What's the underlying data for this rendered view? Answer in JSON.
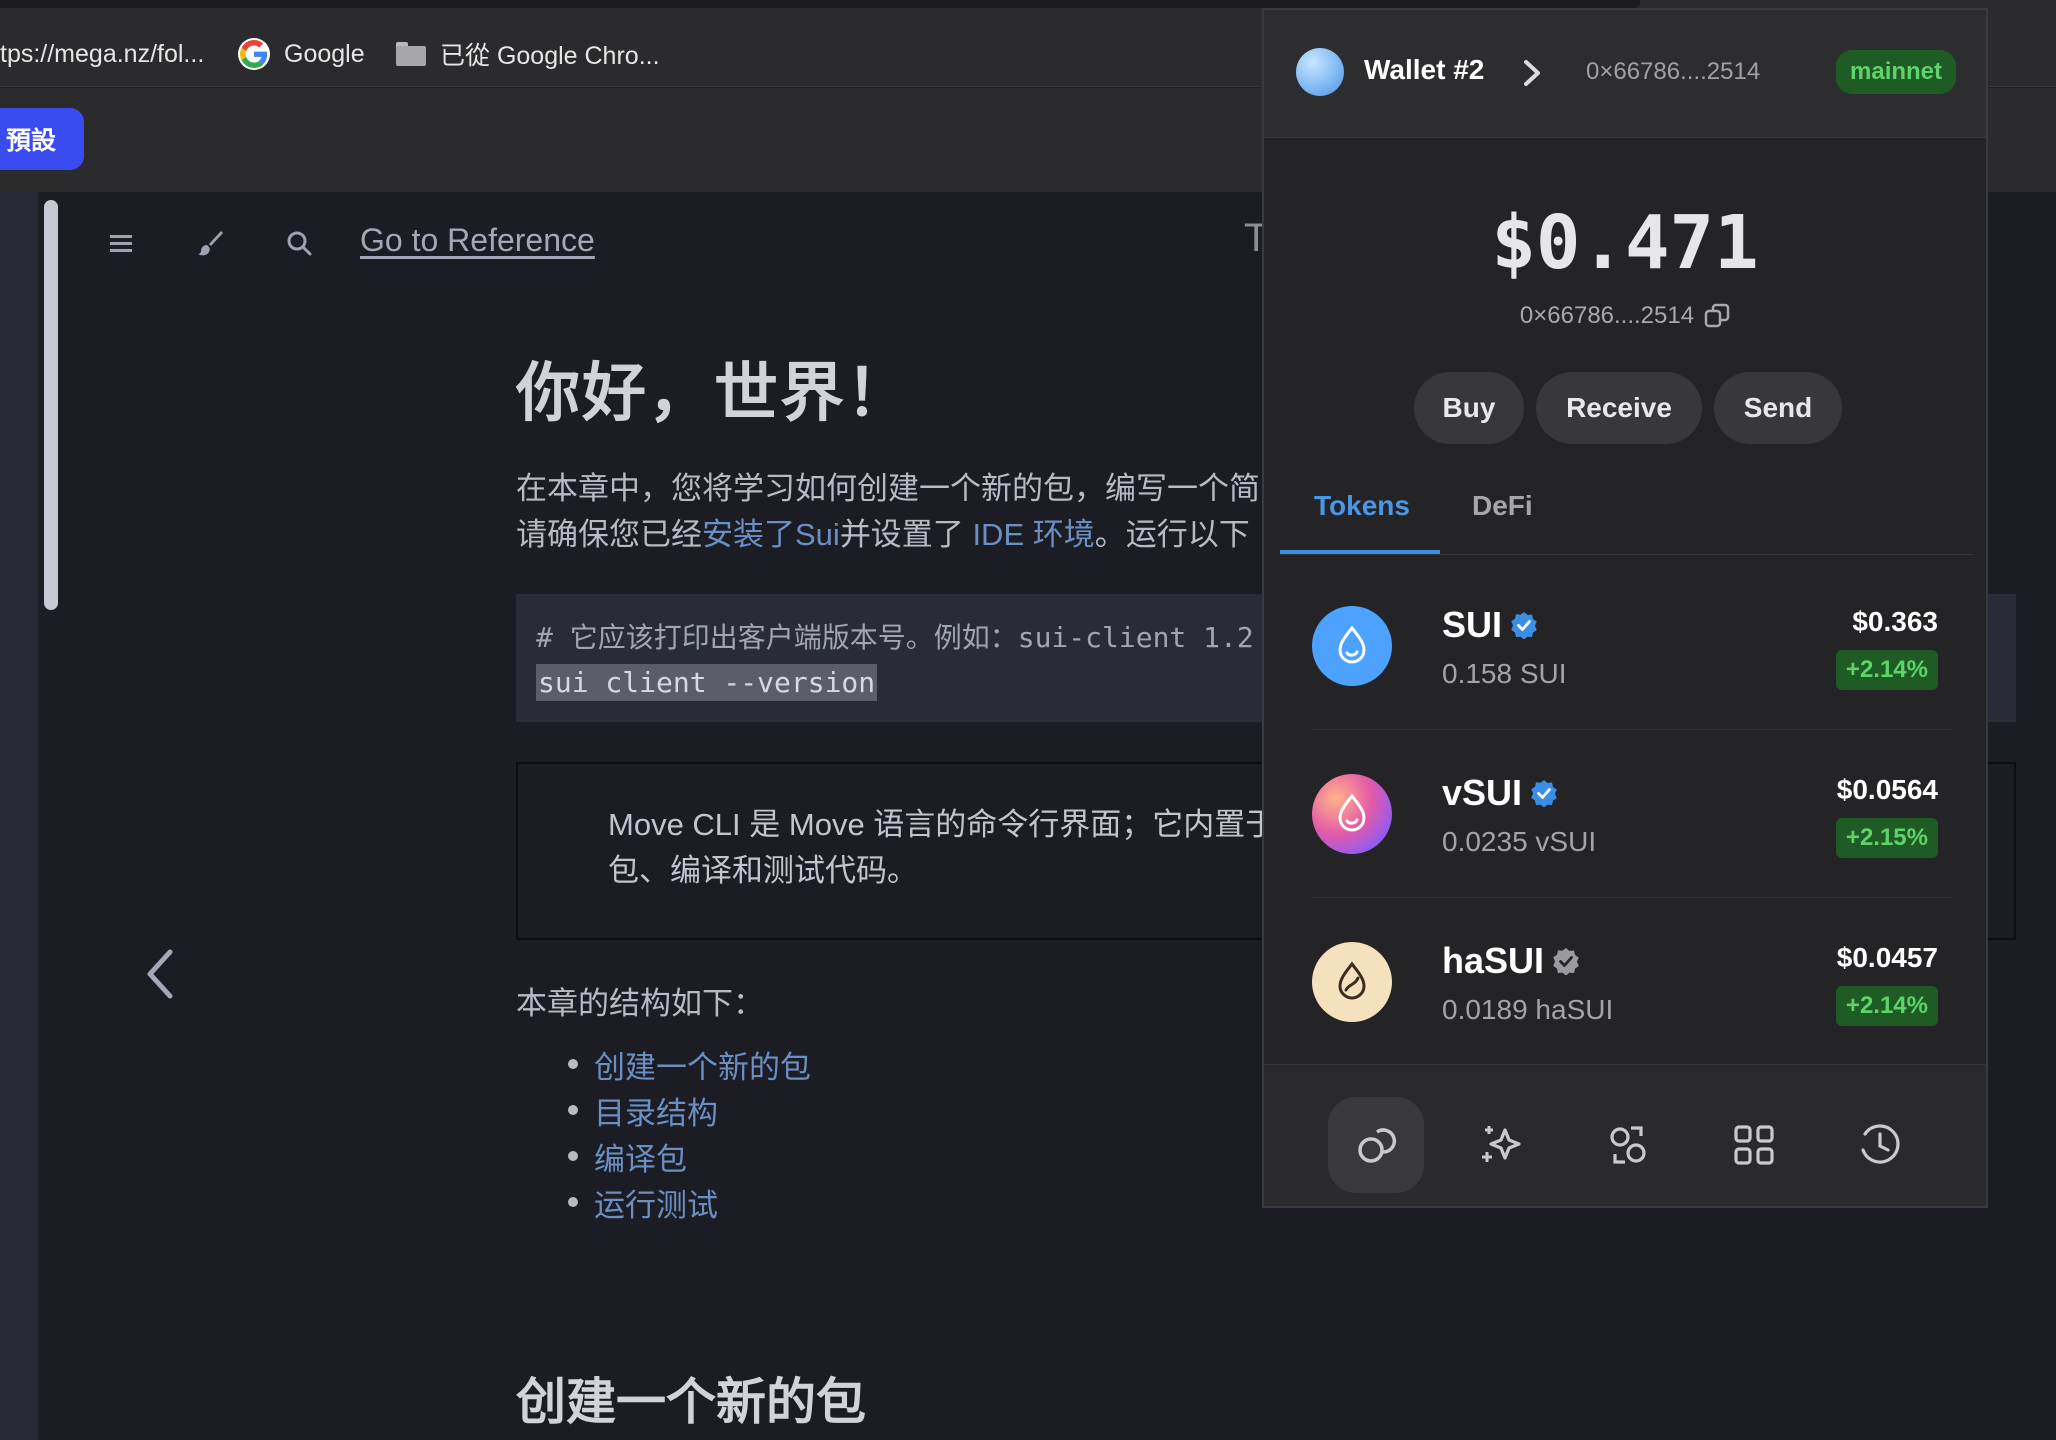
{
  "browser": {
    "bookmarks": [
      {
        "label": "tps://mega.nz/fol..."
      },
      {
        "label": "Google",
        "icon": "google-icon"
      },
      {
        "label": "已從 Google Chro...",
        "icon": "folder-icon"
      }
    ],
    "preset_button": "預設"
  },
  "docs": {
    "toolbar": {
      "goto_reference": "Go to Reference",
      "title_fragment": "T"
    },
    "heading": "你好，世界！",
    "intro_line1": "在本章中，您将学习如何创建一个新的包，编写一个简",
    "intro_line2_prefix": "请确保您已经",
    "intro_link_install": "安装了Sui",
    "intro_line2_mid": "并设置了",
    "intro_link_ide": "IDE 环境",
    "intro_line2_suffix": "。运行以下",
    "code_comment": "# 它应该打印出客户端版本号。例如：sui-client 1.2",
    "code_command": "sui client --version",
    "note_line1": "Move CLI 是 Move 语言的命令行界面；它内置于",
    "note_line2": "包、编译和测试代码。",
    "toc_intro": "本章的结构如下：",
    "toc": [
      "创建一个新的包",
      "目录结构",
      "编译包",
      "运行测试"
    ],
    "heading2": "创建一个新的包"
  },
  "wallet": {
    "name": "Wallet #2",
    "address_short": "0×66786....2514",
    "network": "mainnet",
    "balance": "$0.471",
    "address_copy": "0×66786....2514",
    "actions": {
      "buy": "Buy",
      "receive": "Receive",
      "send": "Send"
    },
    "tabs": {
      "tokens": "Tokens",
      "defi": "DeFi"
    },
    "tokens": [
      {
        "symbol": "SUI",
        "amount": "0.158 SUI",
        "usd": "$0.363",
        "change": "+2.14%",
        "verified": "blue"
      },
      {
        "symbol": "vSUI",
        "amount": "0.0235 vSUI",
        "usd": "$0.0564",
        "change": "+2.15%",
        "verified": "blue"
      },
      {
        "symbol": "haSUI",
        "amount": "0.0189 haSUI",
        "usd": "$0.0457",
        "change": "+2.14%",
        "verified": "gray"
      }
    ],
    "nav": [
      "coins-icon",
      "sparkle-icon",
      "swap-icon",
      "apps-grid-icon",
      "history-icon"
    ]
  },
  "colors": {
    "accent_blue": "#3a8ee6",
    "positive_green": "#5ed36a",
    "positive_bg": "#1f5b24",
    "preset_button": "#3b4bf2"
  }
}
